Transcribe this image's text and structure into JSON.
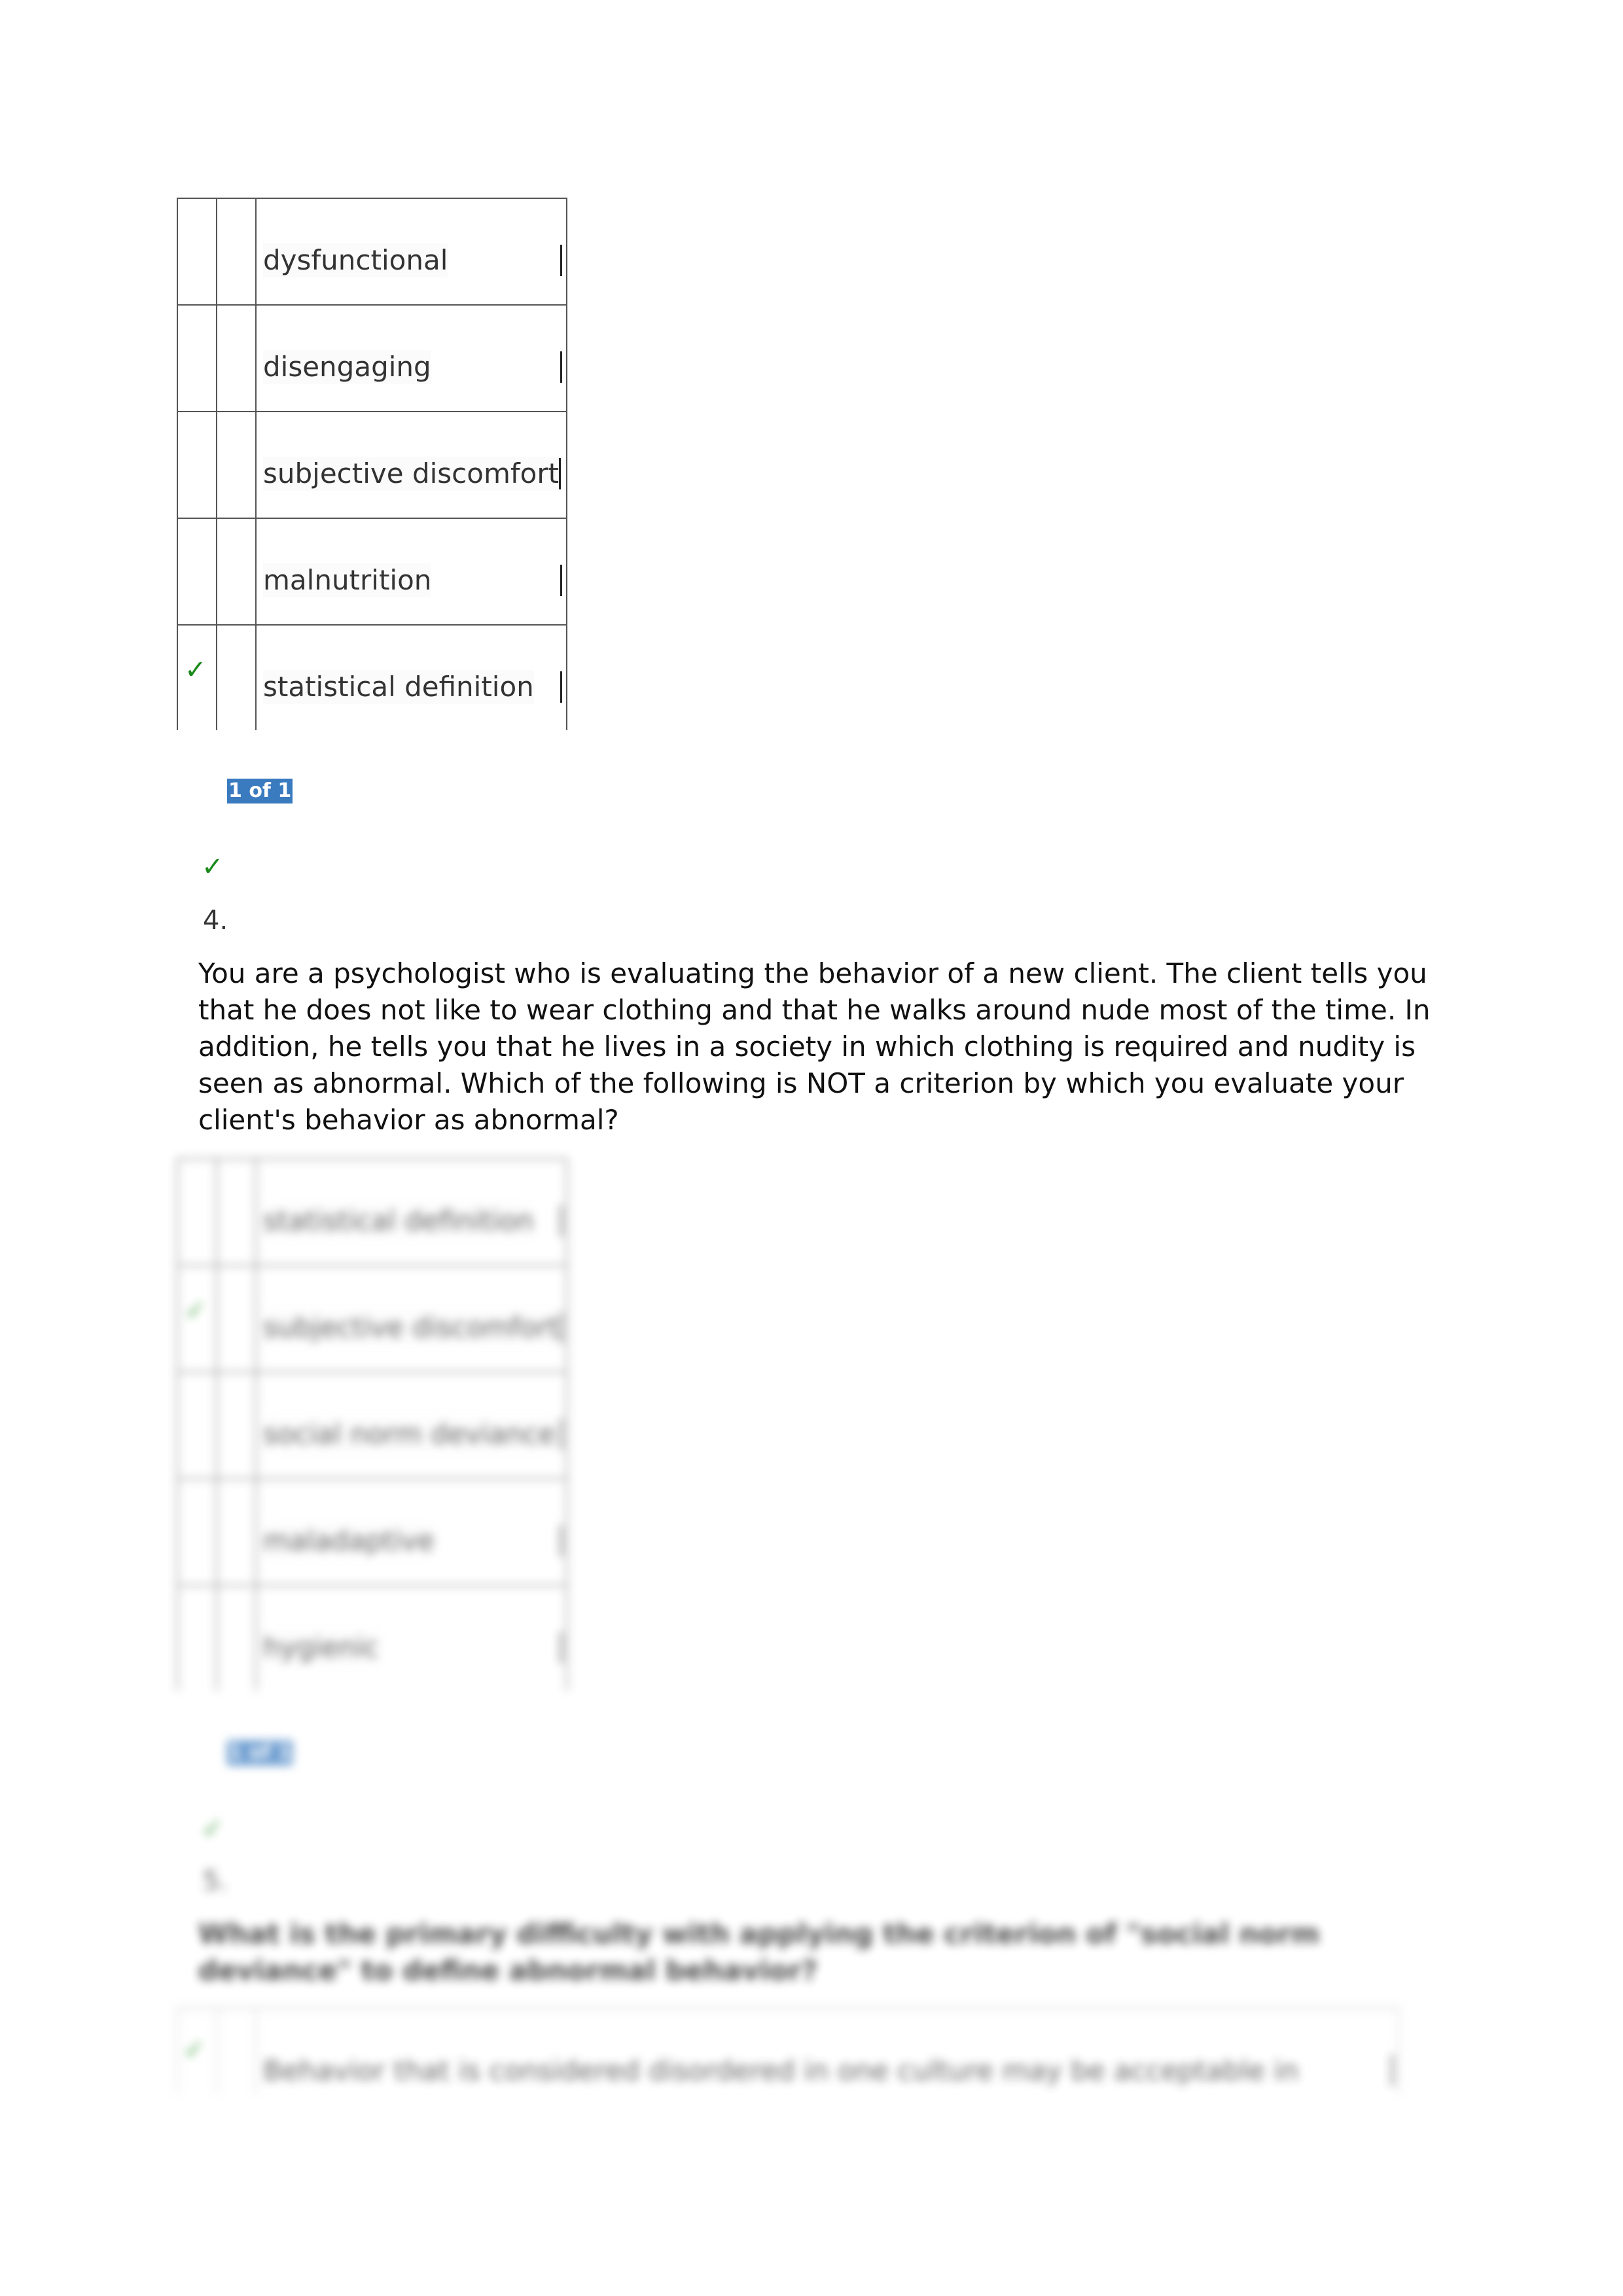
{
  "question3": {
    "options": [
      {
        "label": "dysfunctional",
        "selected": false
      },
      {
        "label": "disengaging",
        "selected": false
      },
      {
        "label": "subjective discomfort",
        "selected": false
      },
      {
        "label": "malnutrition",
        "selected": false
      },
      {
        "label": "statistical definition",
        "selected": true
      }
    ],
    "score_badge": "1 of 1",
    "result_icon": "check-icon"
  },
  "question4": {
    "number": "4.",
    "text": "You are a psychologist who is evaluating the behavior of a new client. The client tells you that he does not like to wear clothing and that he walks around nude most of the time. In addition, he tells you that he lives in a society in which clothing is required and nudity is seen as abnormal. Which of the following is NOT a criterion by which you evaluate your client's behavior as abnormal?",
    "options": [
      {
        "label": "statistical definition",
        "selected": false
      },
      {
        "label": "subjective discomfort",
        "selected": true
      },
      {
        "label": "social norm deviance",
        "selected": false
      },
      {
        "label": "maladaptive",
        "selected": false
      },
      {
        "label": "hygienic",
        "selected": false
      }
    ],
    "score_badge": "1 of 1",
    "result_icon": "check-icon",
    "blurred_options": true
  },
  "question5": {
    "number": "5.",
    "text": "What is the primary difficulty with applying the criterion of \"social norm deviance\" to define abnormal behavior?",
    "options": [
      {
        "label": "Behavior that is considered disordered in one culture may be acceptable in",
        "selected": true
      }
    ],
    "blurred": true
  },
  "colors": {
    "check": "#1a8a1a",
    "badge_bg": "#3a7bc0",
    "badge_text": "#ffffff",
    "border": "#555555",
    "text": "#333333"
  }
}
